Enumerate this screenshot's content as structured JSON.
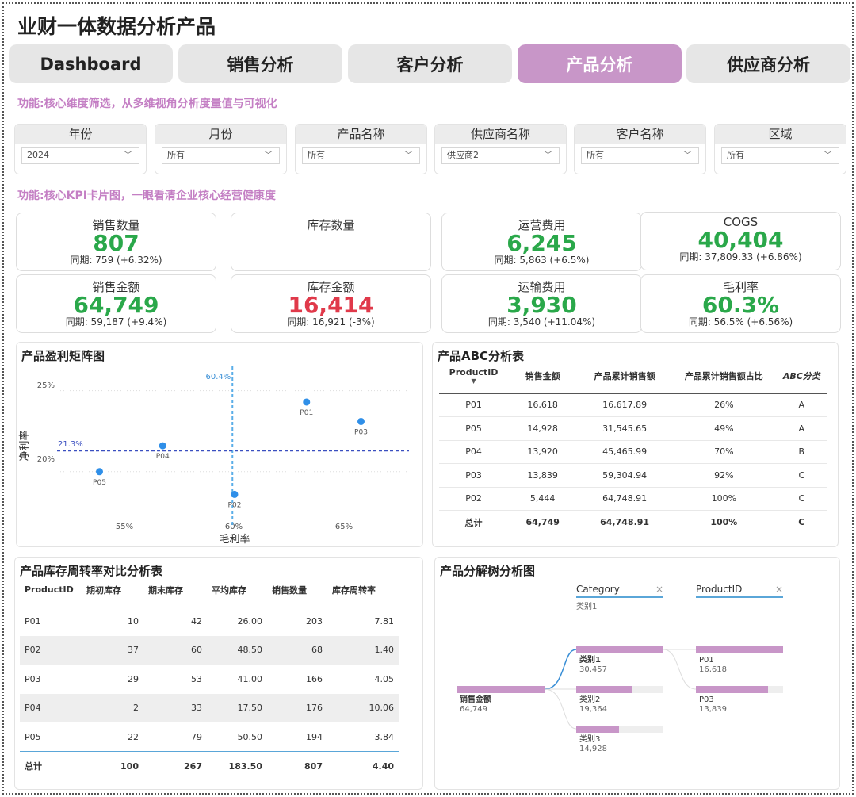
{
  "page_title": "业财一体数据分析产品",
  "tabs": [
    {
      "label": "Dashboard"
    },
    {
      "label": "销售分析"
    },
    {
      "label": "客户分析"
    },
    {
      "label": "产品分析"
    },
    {
      "label": "供应商分析"
    }
  ],
  "active_tab": "产品分析",
  "note_filters": "功能:核心维度筛选，从多维视角分析度量值与可视化",
  "note_kpi": "功能:核心KPI卡片图，一眼看清企业核心经营健康度",
  "filters": [
    {
      "label": "年份",
      "value": "2024"
    },
    {
      "label": "月份",
      "value": "所有"
    },
    {
      "label": "产品名称",
      "value": "所有"
    },
    {
      "label": "供应商名称",
      "value": "供应商2"
    },
    {
      "label": "客户名称",
      "value": "所有"
    },
    {
      "label": "区域",
      "value": "所有"
    }
  ],
  "kpis": [
    {
      "title": "销售数量",
      "value": "807",
      "sub": "同期: 759 (+6.32%)",
      "color": "#2aa84a"
    },
    {
      "title": "库存数量",
      "value": "",
      "sub": "",
      "color": "#2aa84a"
    },
    {
      "title": "运营费用",
      "value": "6,245",
      "sub": "同期: 5,863 (+6.5%)",
      "color": "#2aa84a"
    },
    {
      "title": "COGS",
      "value": "40,404",
      "sub": "同期: 37,809.33 (+6.86%)",
      "color": "#2aa84a"
    },
    {
      "title": "销售金额",
      "value": "64,749",
      "sub": "同期: 59,187 (+9.4%)",
      "color": "#2aa84a"
    },
    {
      "title": "库存金额",
      "value": "16,414",
      "sub": "同期: 16,921 (-3%)",
      "color": "#e0394a"
    },
    {
      "title": "运输费用",
      "value": "3,930",
      "sub": "同期: 3,540 (+11.04%)",
      "color": "#2aa84a"
    },
    {
      "title": "毛利率",
      "value": "60.3%",
      "sub": "同期: 56.5% (+6.56%)",
      "color": "#2aa84a"
    }
  ],
  "matrix": {
    "title": "产品盈利矩阵图",
    "xlabel": "毛利率",
    "ylabel": "净利率",
    "x_ticks": [
      "55%",
      "60%",
      "65%"
    ],
    "y_ticks": [
      "25%",
      "20%"
    ],
    "vline_label": "60.4%",
    "hline_label": "21.3%"
  },
  "chart_data": {
    "type": "scatter",
    "title": "产品盈利矩阵图",
    "xlabel": "毛利率",
    "ylabel": "净利率",
    "xlim": [
      52.5,
      68.5
    ],
    "ylim": [
      17.2,
      26.5
    ],
    "x_ticks": [
      55,
      60,
      65
    ],
    "y_ticks": [
      20,
      25
    ],
    "reference_lines": {
      "x": 60.4,
      "y": 21.3
    },
    "points": [
      {
        "label": "P01",
        "x": 63.8,
        "y": 24.3
      },
      {
        "label": "P03",
        "x": 66.3,
        "y": 23.1
      },
      {
        "label": "P04",
        "x": 57.2,
        "y": 21.6
      },
      {
        "label": "P05",
        "x": 54.3,
        "y": 20.0
      },
      {
        "label": "P02",
        "x": 60.5,
        "y": 18.6
      }
    ]
  },
  "abc": {
    "title": "产品ABC分析表",
    "headers": [
      "ProductID",
      "销售金额",
      "产品累计销售额",
      "产品累计销售额占比",
      "ABC分类"
    ],
    "rows": [
      [
        "P01",
        "16,618",
        "16,617.89",
        "26%",
        "A"
      ],
      [
        "P05",
        "14,928",
        "31,545.65",
        "49%",
        "A"
      ],
      [
        "P04",
        "13,920",
        "45,465.99",
        "70%",
        "B"
      ],
      [
        "P03",
        "13,839",
        "59,304.94",
        "92%",
        "C"
      ],
      [
        "P02",
        "5,444",
        "64,748.91",
        "100%",
        "C"
      ]
    ],
    "total": [
      "总计",
      "64,749",
      "64,748.91",
      "100%",
      "C"
    ]
  },
  "inventory": {
    "title": "产品库存周转率对比分析表",
    "headers": [
      "ProductID",
      "期初库存",
      "期末库存",
      "平均库存",
      "销售数量",
      "库存周转率"
    ],
    "rows": [
      [
        "P01",
        "10",
        "42",
        "26.00",
        "203",
        "7.81"
      ],
      [
        "P02",
        "37",
        "60",
        "48.50",
        "68",
        "1.40"
      ],
      [
        "P03",
        "29",
        "53",
        "41.00",
        "166",
        "4.05"
      ],
      [
        "P04",
        "2",
        "33",
        "17.50",
        "176",
        "10.06"
      ],
      [
        "P05",
        "22",
        "79",
        "50.50",
        "194",
        "3.84"
      ]
    ],
    "total": [
      "总计",
      "100",
      "267",
      "183.50",
      "807",
      "4.40"
    ]
  },
  "tree": {
    "title": "产品分解树分析图",
    "level1_header": "Category",
    "level1_sub": "类别1",
    "level2_header": "ProductID",
    "root": {
      "label": "销售金额",
      "value": "64,749",
      "fill": 1.0
    },
    "categories": [
      {
        "label": "类别1",
        "value": "30,457",
        "fill": 1.0
      },
      {
        "label": "类别2",
        "value": "19,364",
        "fill": 0.64
      },
      {
        "label": "类别3",
        "value": "14,928",
        "fill": 0.49
      }
    ],
    "products": [
      {
        "label": "P01",
        "value": "16,618",
        "fill": 1.0
      },
      {
        "label": "P03",
        "value": "13,839",
        "fill": 0.83
      }
    ]
  }
}
